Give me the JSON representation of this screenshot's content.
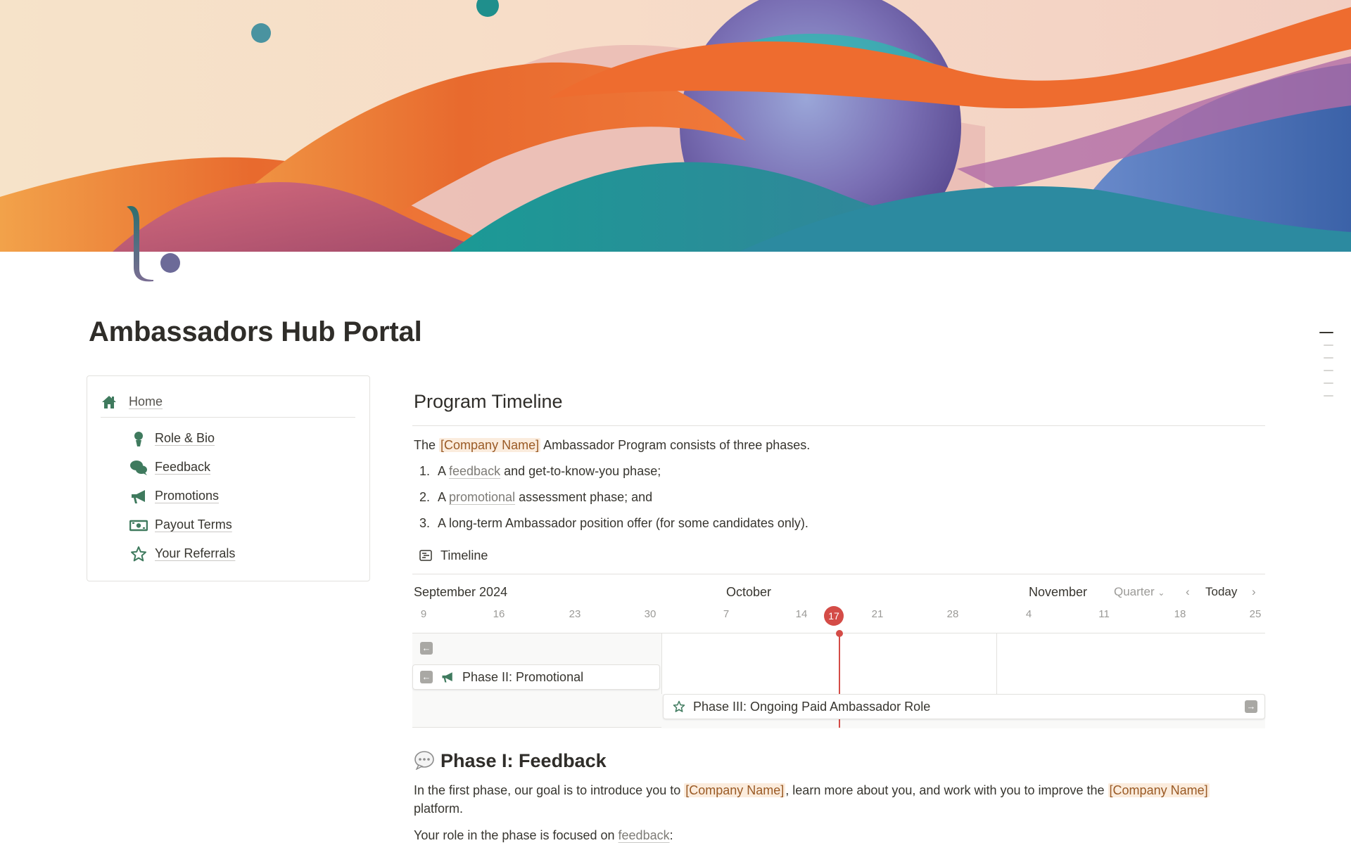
{
  "page": {
    "title": "Ambassadors Hub Portal",
    "accent_color": "#3f7a5e",
    "highlight_bg": "#fbecdd",
    "today_color": "#d44c47"
  },
  "nav": {
    "home": {
      "label": "Home",
      "icon": "home-icon"
    },
    "items": [
      {
        "label": "Role & Bio",
        "icon": "user-icon"
      },
      {
        "label": "Feedback",
        "icon": "chat-bubbles-icon"
      },
      {
        "label": "Promotions",
        "icon": "megaphone-icon"
      },
      {
        "label": "Payout Terms",
        "icon": "money-icon"
      },
      {
        "label": "Your Referrals",
        "icon": "star-icon"
      }
    ]
  },
  "program": {
    "heading": "Program Timeline",
    "intro_pre": "The ",
    "company": "[Company Name]",
    "intro_post": " Ambassador Program consists of three phases.",
    "list": [
      {
        "num": "1.",
        "pre": "A ",
        "link": "feedback",
        "post": " and get-to-know-you phase;"
      },
      {
        "num": "2.",
        "pre": "A ",
        "link": "promotional",
        "post": " assessment phase; and"
      },
      {
        "num": "3.",
        "pre": "A long-term Ambassador position offer (for some candidates only).",
        "link": "",
        "post": ""
      }
    ]
  },
  "timeline": {
    "view_label": "Timeline",
    "view_icon": "timeline-icon",
    "months": [
      "September 2024",
      "October",
      "November"
    ],
    "days": [
      "9",
      "16",
      "23",
      "30",
      "7",
      "14",
      "21",
      "28",
      "4",
      "11",
      "18",
      "25"
    ],
    "today": "17",
    "scale_label": "Quarter",
    "today_button": "Today",
    "prev_icon": "chevron-left-icon",
    "next_icon": "chevron-right-icon",
    "items": [
      {
        "label": "Phase II: Promotional",
        "icon": "megaphone-icon",
        "offscreen": "left"
      },
      {
        "label": "Phase III: Ongoing Paid Ambassador Role",
        "icon": "star-icon",
        "offscreen": "right"
      }
    ]
  },
  "phase1": {
    "emoji": "speech-bubble-icon",
    "title": "Phase I: Feedback",
    "p1_a": "In the first phase, our goal is to introduce you to ",
    "p1_b": ", learn more about you, and work with you to improve the ",
    "p1_c": "platform.",
    "p2_pre": "Your role in the phase is focused on ",
    "p2_link": "feedback",
    "p2_post": ":"
  }
}
